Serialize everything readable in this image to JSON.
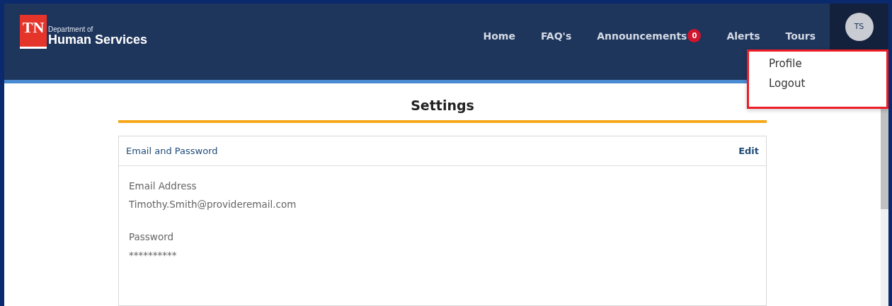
{
  "logo": {
    "mark": "TN",
    "line1": "Department of",
    "line2": "Human Services"
  },
  "nav": [
    {
      "label": "Home"
    },
    {
      "label": "FAQ's"
    },
    {
      "label": "Announcements",
      "badge": "0"
    },
    {
      "label": "Alerts"
    },
    {
      "label": "Tours"
    }
  ],
  "avatar": {
    "initials": "TS"
  },
  "user_menu": {
    "expanded": true,
    "items": [
      "Profile",
      "Logout"
    ]
  },
  "page_title": "Settings",
  "card": {
    "title": "Email and Password",
    "action": "Edit",
    "fields": [
      {
        "label": "Email Address",
        "value": "Timothy.Smith@provideremail.com"
      },
      {
        "label": "Password",
        "value": "**********"
      }
    ]
  }
}
